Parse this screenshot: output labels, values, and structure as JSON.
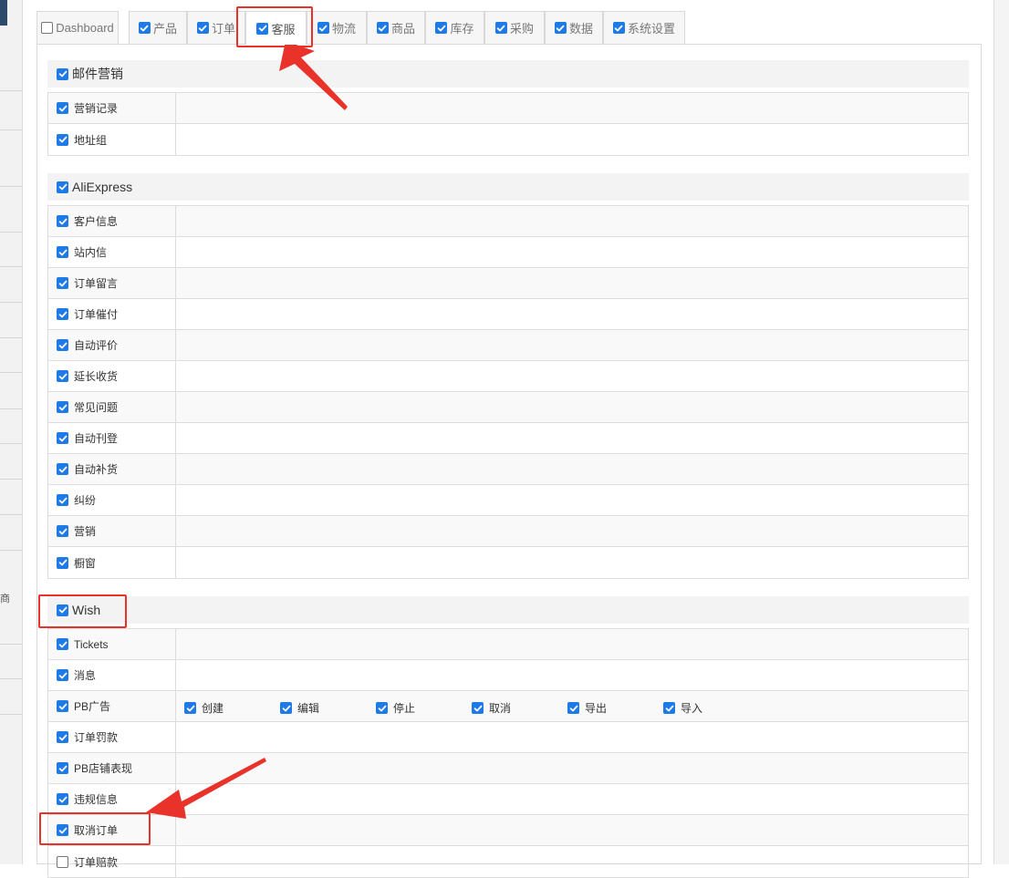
{
  "tabs": [
    {
      "label": "Dashboard",
      "checked": false
    },
    {
      "label": "产品",
      "checked": true
    },
    {
      "label": "订单",
      "checked": true
    },
    {
      "label": "客服",
      "checked": true,
      "active": true
    },
    {
      "label": "物流",
      "checked": true
    },
    {
      "label": "商品",
      "checked": true
    },
    {
      "label": "库存",
      "checked": true
    },
    {
      "label": "采购",
      "checked": true
    },
    {
      "label": "数据",
      "checked": true
    },
    {
      "label": "系统设置",
      "checked": true
    }
  ],
  "sections": [
    {
      "title": "邮件营销",
      "rows": [
        {
          "label": "营销记录"
        },
        {
          "label": "地址组"
        }
      ]
    },
    {
      "title": "AliExpress",
      "rows": [
        {
          "label": "客户信息"
        },
        {
          "label": "站内信"
        },
        {
          "label": "订单留言"
        },
        {
          "label": "订单催付"
        },
        {
          "label": "自动评价"
        },
        {
          "label": "延长收货"
        },
        {
          "label": "常见问题"
        },
        {
          "label": "自动刊登"
        },
        {
          "label": "自动补货"
        },
        {
          "label": "纠纷"
        },
        {
          "label": "营销"
        },
        {
          "label": "橱窗"
        }
      ]
    },
    {
      "title": "Wish",
      "rows": [
        {
          "label": "Tickets"
        },
        {
          "label": "消息"
        },
        {
          "label": "PB广告",
          "ops": [
            "创建",
            "编辑",
            "停止",
            "取消",
            "导出",
            "导入"
          ]
        },
        {
          "label": "订单罚款"
        },
        {
          "label": "PB店铺表现"
        },
        {
          "label": "违规信息"
        },
        {
          "label": "取消订单"
        },
        {
          "label": "订单赔款",
          "checked": false
        }
      ]
    }
  ],
  "colors": {
    "checkbox": "#1e7ae6",
    "annotation": "#e8322a",
    "section_bg": "#f3f3f3"
  },
  "icons": {
    "check": "checkmark-icon",
    "arrow": "annotation-arrow"
  },
  "left_fragment": "商"
}
